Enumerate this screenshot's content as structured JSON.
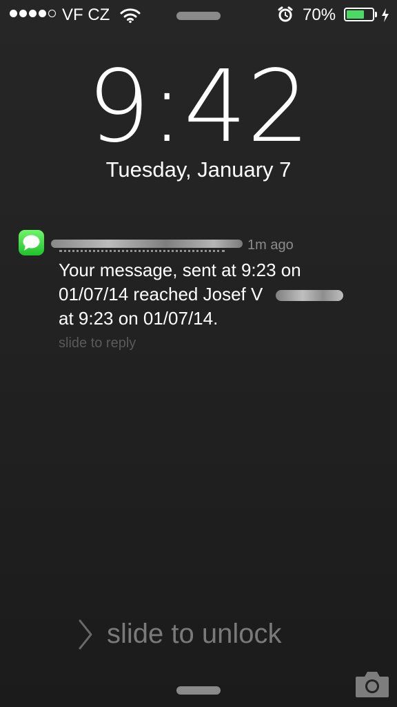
{
  "status_bar": {
    "signal_bars_filled": 4,
    "signal_bars_total": 5,
    "carrier": "VF CZ",
    "battery_percent": "70%",
    "battery_level": 0.7,
    "battery_color": "#4cd964"
  },
  "lock_screen": {
    "time": "9:42",
    "date": "Tuesday, January 7",
    "unlock_hint": "slide to unlock"
  },
  "notification": {
    "app_icon": "messages-icon",
    "sender": "",
    "time_ago": "1m ago",
    "body": "Your message, sent at 9:23 on\n01/07/14 reached Josef V\nat 9:23 on 01/07/14.",
    "reply_hint": "slide to reply"
  },
  "icons": {
    "wifi": "wifi-icon",
    "alarm": "alarm-clock-icon",
    "charging": "lightning-bolt-icon",
    "camera": "camera-icon",
    "chevron": "chevron-right-icon"
  }
}
